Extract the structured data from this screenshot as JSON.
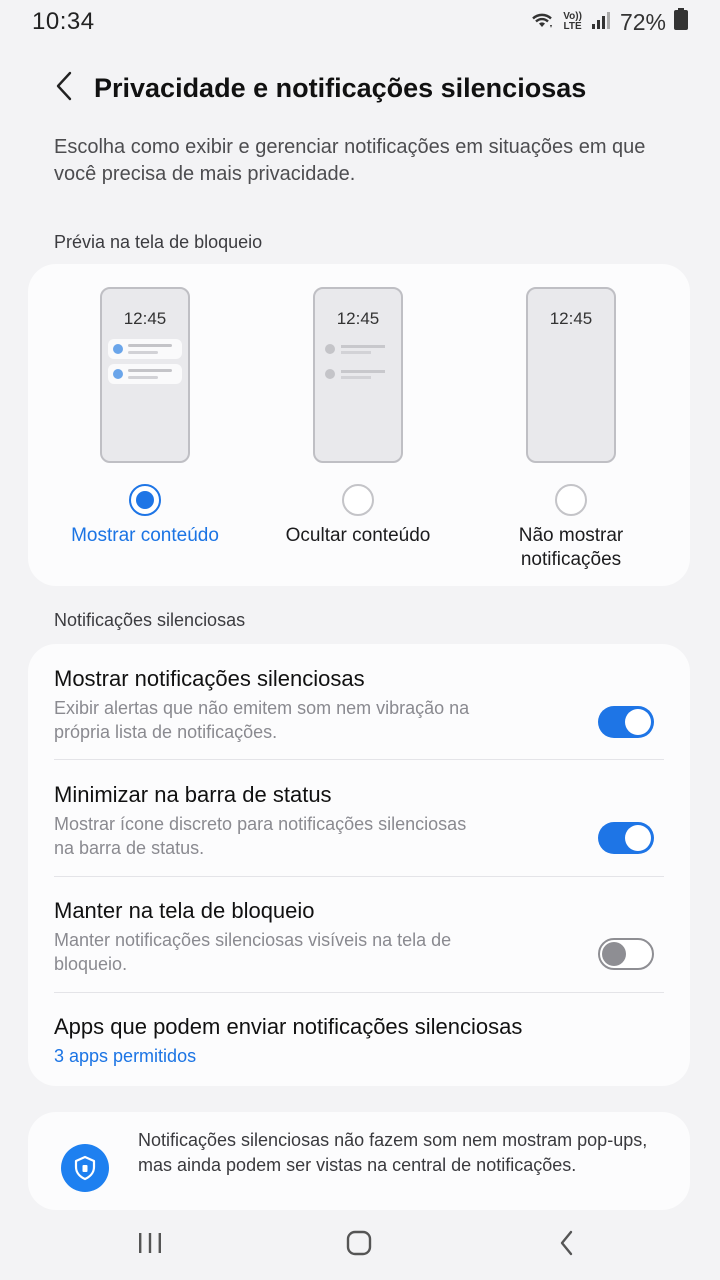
{
  "status_bar": {
    "time": "10:34",
    "volte_top": "Vo))",
    "volte_bottom": "LTE",
    "battery": "72%"
  },
  "header": {
    "title": "Privacidade e notificações silenciosas"
  },
  "intro": "Escolha como exibir e gerenciar notificações em situações em que você precisa de mais privacidade.",
  "lock_preview": {
    "section_title": "Prévia na tela de bloqueio",
    "phone_time": "12:45",
    "options": [
      {
        "label": "Mostrar conteúdo",
        "selected": true
      },
      {
        "label": "Ocultar conteúdo",
        "selected": false
      },
      {
        "label": "Não mostrar notificações",
        "selected": false
      }
    ]
  },
  "silent": {
    "section_title": "Notificações silenciosas",
    "rows": [
      {
        "title": "Mostrar notificações silenciosas",
        "subtitle": "Exibir alertas que não emitem som nem vibração na própria lista de notificações.",
        "enabled": true
      },
      {
        "title": "Minimizar na barra de status",
        "subtitle": "Mostrar ícone discreto para notificações silenciosas na barra de status.",
        "enabled": true
      },
      {
        "title": "Manter na tela de bloqueio",
        "subtitle": "Manter notificações silenciosas visíveis na tela de bloqueio.",
        "enabled": false
      }
    ],
    "apps": {
      "title": "Apps que podem enviar notificações silenciosas",
      "subtitle": "3 apps permitidos"
    }
  },
  "info": {
    "text": "Notificações silenciosas não fazem som nem mostram pop-ups, mas ainda podem ser vistas na central de notificações."
  },
  "colors": {
    "accent": "#1e75e6",
    "background": "#f3f3f5",
    "card": "#fcfcfd"
  },
  "icons": [
    "wifi-icon",
    "signal-icon",
    "battery-icon",
    "back-arrow-icon",
    "shield-icon",
    "recent-apps-icon",
    "home-icon",
    "nav-back-icon"
  ]
}
